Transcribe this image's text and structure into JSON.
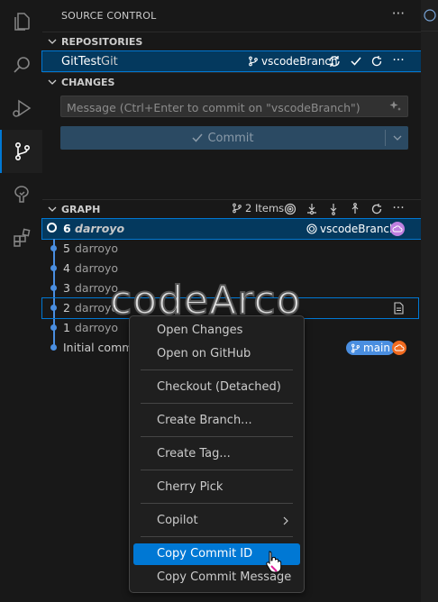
{
  "activity_bar": {
    "items": [
      {
        "icon": "files-icon"
      },
      {
        "icon": "search-icon"
      },
      {
        "icon": "run-debug-icon"
      },
      {
        "icon": "source-control-icon",
        "active": true
      },
      {
        "icon": "remote-explorer-icon"
      },
      {
        "icon": "extensions-icon"
      }
    ]
  },
  "panel": {
    "title": "SOURCE CONTROL",
    "more": "···"
  },
  "repositories": {
    "header": "REPOSITORIES",
    "repo_name": "GitTest",
    "repo_type": "Git",
    "branch": "vscodeBranch",
    "more": "···"
  },
  "changes": {
    "header": "CHANGES",
    "message_placeholder": "Message (Ctrl+Enter to commit on \"vscodeBranch\")",
    "commit_label": "Commit"
  },
  "graph": {
    "header": "GRAPH",
    "item_count": "2 Items",
    "more": "···",
    "commits": [
      {
        "num": "6",
        "author": "darroyo",
        "branch_badge": "vscodeBranch",
        "selected": true
      },
      {
        "num": "5",
        "author": "darroyo"
      },
      {
        "num": "4",
        "author": "darroyo"
      },
      {
        "num": "3",
        "author": "darroyo"
      },
      {
        "num": "2",
        "author": "darroyo"
      },
      {
        "num": "1",
        "author": "darroyo"
      },
      {
        "num": "",
        "author": "Initial commi",
        "branch_badge": "main"
      }
    ]
  },
  "context_menu": {
    "items": [
      {
        "label": "Open Changes"
      },
      {
        "label": "Open on GitHub"
      },
      {
        "label": "Checkout (Detached)"
      },
      {
        "label": "Create Branch..."
      },
      {
        "label": "Create Tag..."
      },
      {
        "label": "Cherry Pick"
      },
      {
        "label": "Copilot",
        "submenu": true
      },
      {
        "label": "Copy Commit ID",
        "highlighted": true
      },
      {
        "label": "Copy Commit Message"
      }
    ]
  },
  "watermark": "codeArco",
  "colors": {
    "accent": "#0078d4",
    "selection": "#04395e",
    "graph_line": "#4a8ee0",
    "main_badge": "#4a8ee0",
    "cloud_orange": "#f06a1f",
    "cloud_purple": "#c080e0"
  }
}
